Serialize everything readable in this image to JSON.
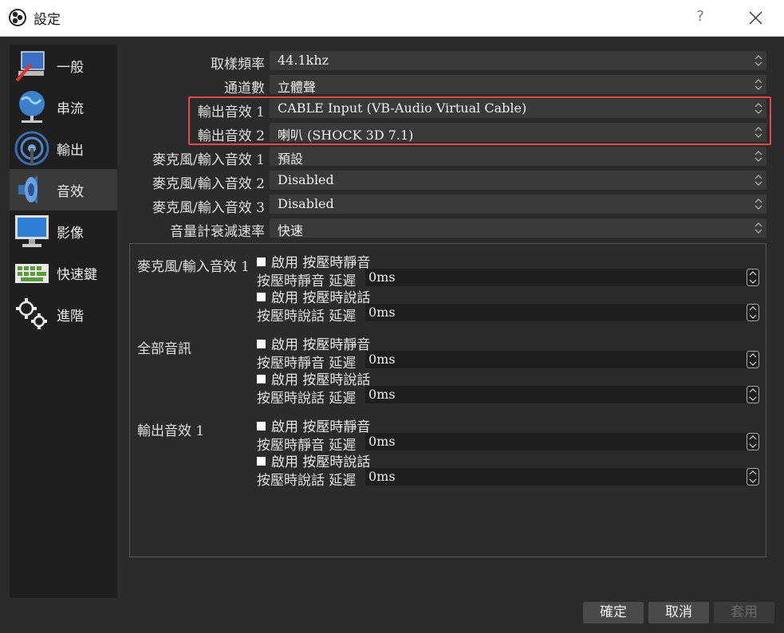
{
  "window": {
    "title": "設定",
    "help": "?"
  },
  "sidebar": {
    "items": [
      {
        "label": "一般",
        "icon": "general-icon"
      },
      {
        "label": "串流",
        "icon": "stream-globe-icon"
      },
      {
        "label": "輸出",
        "icon": "output-broadcast-icon"
      },
      {
        "label": "音效",
        "icon": "speaker-icon",
        "active": true
      },
      {
        "label": "影像",
        "icon": "monitor-icon"
      },
      {
        "label": "快速鍵",
        "icon": "keyboard-icon"
      },
      {
        "label": "進階",
        "icon": "gears-icon"
      }
    ]
  },
  "audio": {
    "sample_rate": {
      "label": "取樣頻率",
      "value": "44.1khz"
    },
    "channels": {
      "label": "通道數",
      "value": "立體聲"
    },
    "desktop1": {
      "label": "輸出音效 1",
      "value": "CABLE Input (VB-Audio Virtual Cable)"
    },
    "desktop2": {
      "label": "輸出音效 2",
      "value": "喇叭 (SHOCK 3D 7.1)"
    },
    "mic1": {
      "label": "麥克風/輸入音效 1",
      "value": "預設"
    },
    "mic2": {
      "label": "麥克風/輸入音效 2",
      "value": "Disabled"
    },
    "mic3": {
      "label": "麥克風/輸入音效 3",
      "value": "Disabled"
    },
    "meter_decay": {
      "label": "音量計衰減速率",
      "value": "快速"
    }
  },
  "hotkey_groups": [
    {
      "name": "麥克風/輸入音效 1",
      "push_to_mute": "啟用 按壓時靜音",
      "push_to_mute_delay_label": "按壓時靜音 延遲",
      "push_to_mute_delay": "0ms",
      "push_to_talk": "啟用 按壓時說話",
      "push_to_talk_delay_label": "按壓時說話 延遲",
      "push_to_talk_delay": "0ms"
    },
    {
      "name": "全部音訊",
      "push_to_mute": "啟用 按壓時靜音",
      "push_to_mute_delay_label": "按壓時靜音 延遲",
      "push_to_mute_delay": "0ms",
      "push_to_talk": "啟用 按壓時說話",
      "push_to_talk_delay_label": "按壓時說話 延遲",
      "push_to_talk_delay": "0ms"
    },
    {
      "name": "輸出音效 1",
      "push_to_mute": "啟用 按壓時靜音",
      "push_to_mute_delay_label": "按壓時靜音 延遲",
      "push_to_mute_delay": "0ms",
      "push_to_talk": "啟用 按壓時說話",
      "push_to_talk_delay_label": "按壓時說話 延遲",
      "push_to_talk_delay": "0ms"
    }
  ],
  "buttons": {
    "ok": "確定",
    "cancel": "取消",
    "apply": "套用"
  },
  "colors": {
    "highlight": "#e04a4a",
    "background": "#2b2b2b",
    "sidebar": "#1f1f1f"
  }
}
